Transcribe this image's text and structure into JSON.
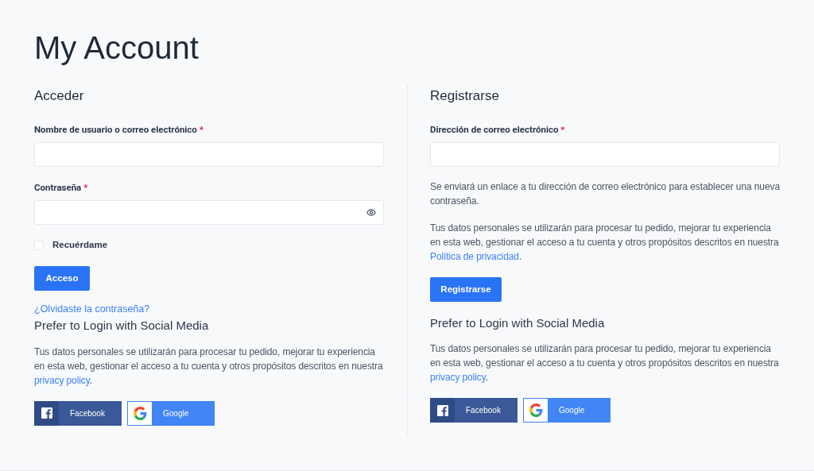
{
  "title": "My Account",
  "login": {
    "heading": "Acceder",
    "fields": [
      {
        "label": "Nombre de usuario o correo electrónico",
        "required_mark": "*"
      },
      {
        "label": "Contraseña",
        "required_mark": "*",
        "kind": "password"
      }
    ],
    "remember": {
      "label": "Recuérdame",
      "checked": false
    },
    "button": "Acceso",
    "forgot_link": "¿Olvidaste la contraseña?",
    "social": {
      "heading": "Prefer to Login with Social Media",
      "text": {
        "before": "Tus datos personales se utilizarán para procesar tu pedido, mejorar tu experiencia en esta web, gestionar el acceso a tu cuenta y otros propósitos descritos en nuestra ",
        "link": "privacy policy",
        "after": "."
      },
      "buttons": [
        {
          "kind": "facebook",
          "label": "Facebook"
        },
        {
          "kind": "google",
          "label": "Google"
        }
      ]
    }
  },
  "register": {
    "heading": "Registrarse",
    "fields": [
      {
        "label": "Dirección de correo electrónico",
        "required_mark": "*"
      }
    ],
    "notes": [
      {
        "before": "Se enviará un enlace a tu dirección de correo electrónico para establecer una nueva contraseña."
      },
      {
        "before": "Tus datos personales se utilizarán para procesar tu pedido, mejorar tu experiencia en esta web, gestionar el acceso a tu cuenta y otros propósitos descritos en nuestra ",
        "link": "Política de privacidad",
        "after": "."
      }
    ],
    "button": "Registrarse",
    "social": {
      "heading": "Prefer to Login with Social Media",
      "text": {
        "before": "Tus datos personales se utilizarán para procesar tu pedido, mejorar tu experiencia en esta web, gestionar el acceso a tu cuenta y otros propósitos descritos en nuestra ",
        "link": "privacy policy",
        "after": "."
      },
      "buttons": [
        {
          "kind": "facebook",
          "label": "Facebook"
        },
        {
          "kind": "google",
          "label": "Google"
        }
      ]
    }
  }
}
